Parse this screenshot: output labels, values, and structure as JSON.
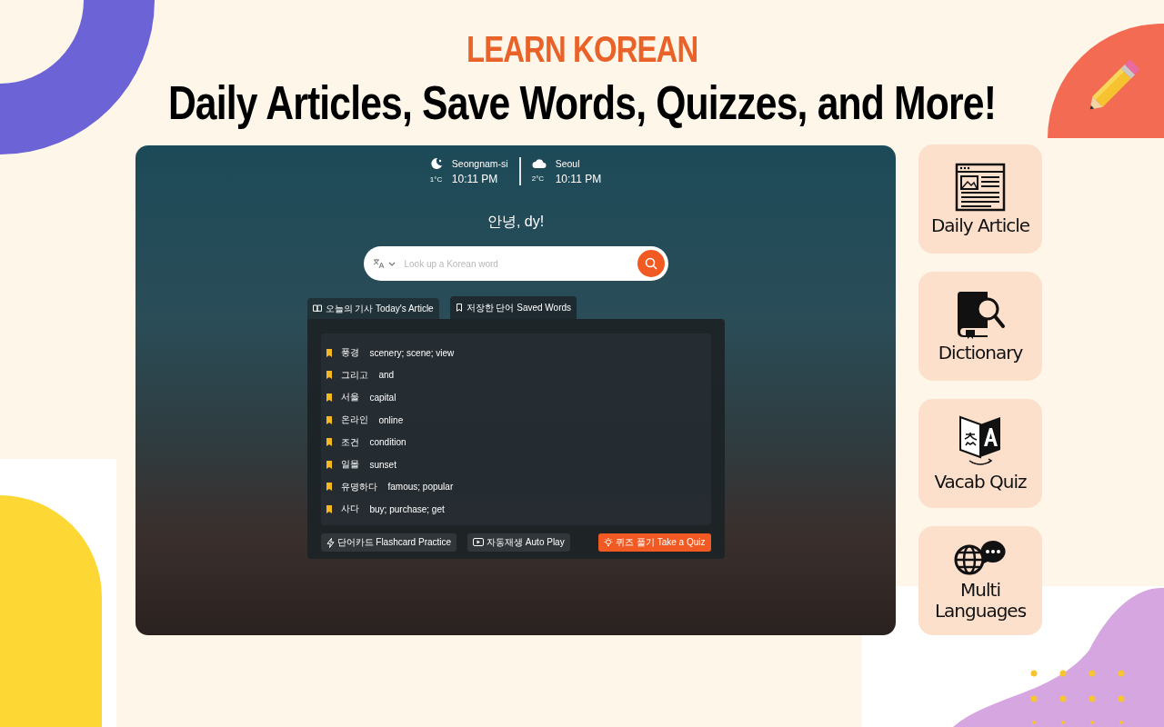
{
  "header": {
    "eyebrow": "LEARN KOREAN",
    "headline": "Daily Articles, Save Words, Quizzes, and More!"
  },
  "app": {
    "weather": [
      {
        "city": "Seongnam-si",
        "temperature": "1°C",
        "time": "10:11 PM",
        "kind": "night"
      },
      {
        "city": "Seoul",
        "temperature": "2°C",
        "time": "10:11 PM",
        "kind": "cloudy"
      }
    ],
    "greeting": "안녕, dy!",
    "search": {
      "placeholder": "Look up a Korean word"
    },
    "tabs": [
      {
        "label": "오늘의 기사 Today's Article",
        "kind": "article",
        "selected": false
      },
      {
        "label": "저장한 단어 Saved Words",
        "kind": "bookmark",
        "selected": true
      }
    ],
    "saved_words": [
      {
        "word": "풍경",
        "meaning": "scenery; scene; view"
      },
      {
        "word": "그리고",
        "meaning": "and"
      },
      {
        "word": "서울",
        "meaning": "capital"
      },
      {
        "word": "온라인",
        "meaning": "online"
      },
      {
        "word": "조건",
        "meaning": "condition"
      },
      {
        "word": "일몰",
        "meaning": "sunset"
      },
      {
        "word": "유명하다",
        "meaning": "famous; popular"
      },
      {
        "word": "사다",
        "meaning": "buy; purchase; get"
      }
    ],
    "actions": [
      {
        "label": "단어카드 Flashcard Practice",
        "kind": "flashcard"
      },
      {
        "label": "자동재생 Auto Play",
        "kind": "autoplay"
      },
      {
        "label": "퀴즈 풀기 Take a Quiz",
        "kind": "quiz"
      }
    ]
  },
  "features": [
    {
      "label": "Daily Article",
      "kind": "article"
    },
    {
      "label": "Dictionary",
      "kind": "dictionary"
    },
    {
      "label": "Vacab Quiz",
      "kind": "quiz"
    },
    {
      "label": "Multi Languages",
      "kind": "languages"
    }
  ]
}
